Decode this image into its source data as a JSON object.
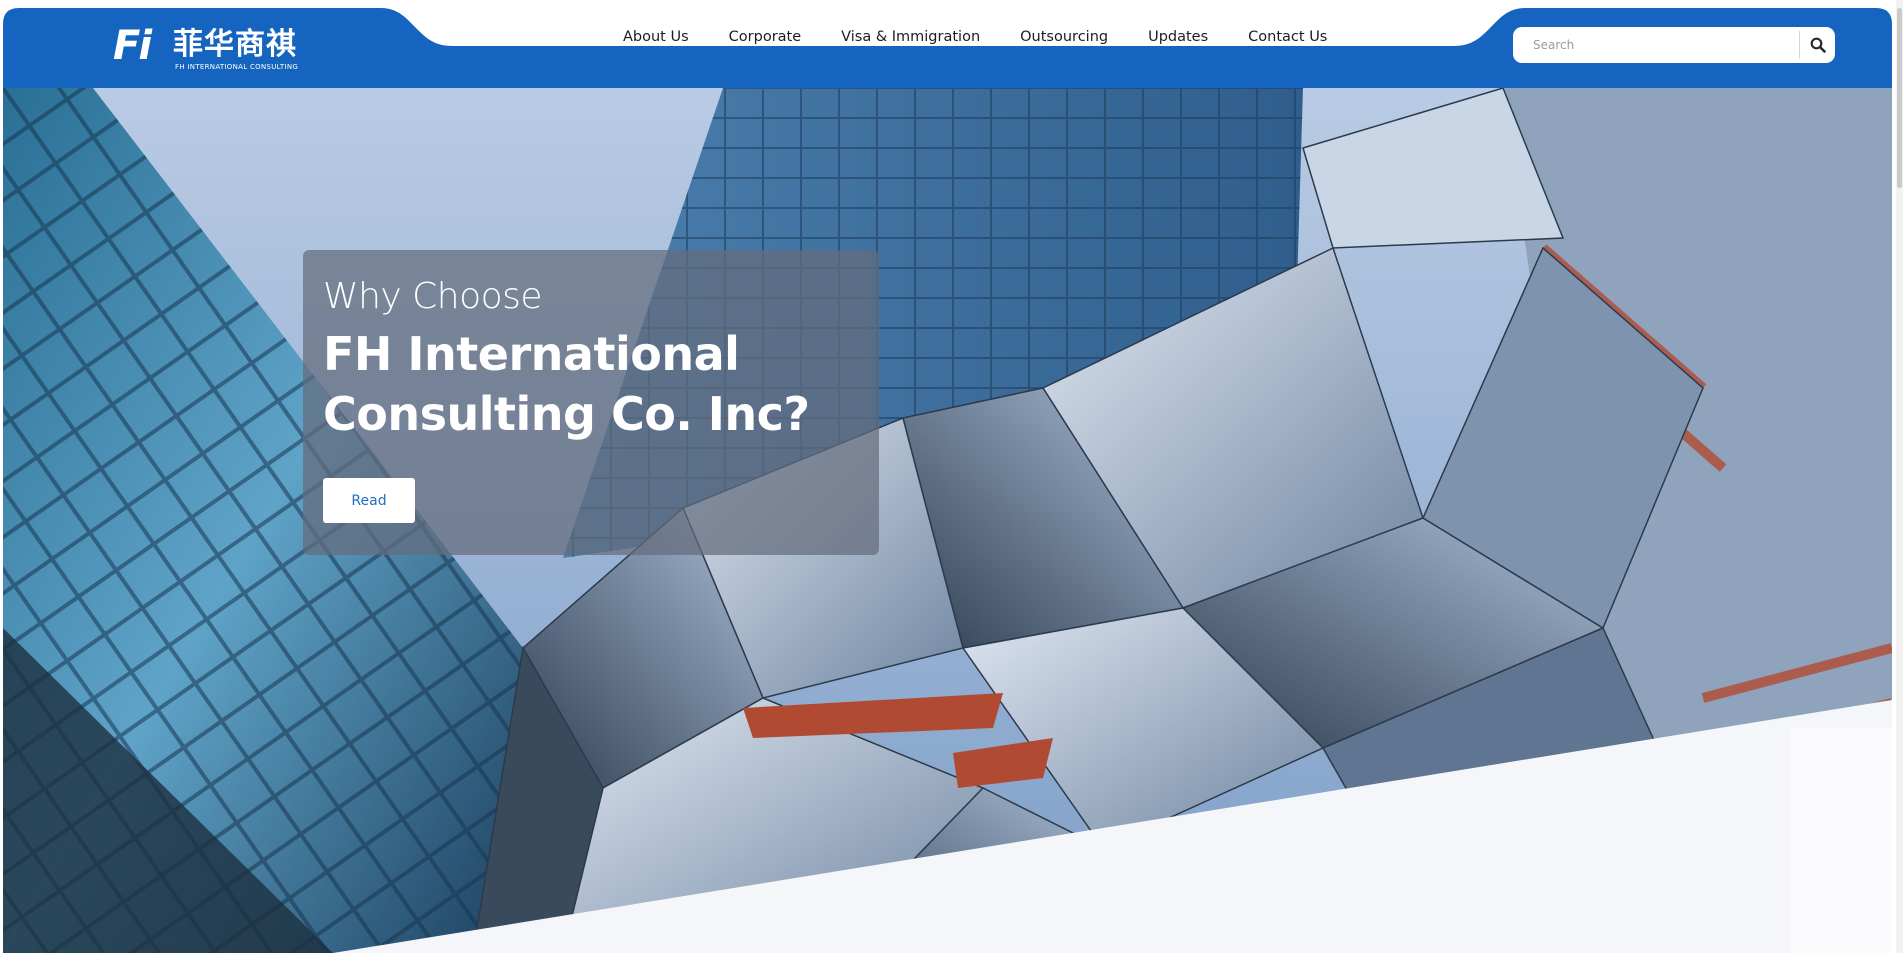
{
  "brand": {
    "logo_mark": "Fi",
    "logo_chinese": "菲华商祺",
    "logo_english": "FH INTERNATIONAL CONSULTING"
  },
  "nav": {
    "items": [
      {
        "label": "About Us"
      },
      {
        "label": "Corporate"
      },
      {
        "label": "Visa & Immigration"
      },
      {
        "label": "Outsourcing"
      },
      {
        "label": "Updates"
      },
      {
        "label": "Contact Us"
      }
    ]
  },
  "search": {
    "placeholder": "Search",
    "value": ""
  },
  "hero": {
    "eyebrow": "Why Choose",
    "title": "FH International Consulting Co. Inc?",
    "button_label": "Read"
  },
  "colors": {
    "brand_blue": "#1565c0",
    "card_overlay": "rgba(100,108,125,0.72)",
    "button_text": "#1f6fc5",
    "bottom_section": "#f4f6fa"
  },
  "icons": {
    "search": "magnifier-icon"
  }
}
